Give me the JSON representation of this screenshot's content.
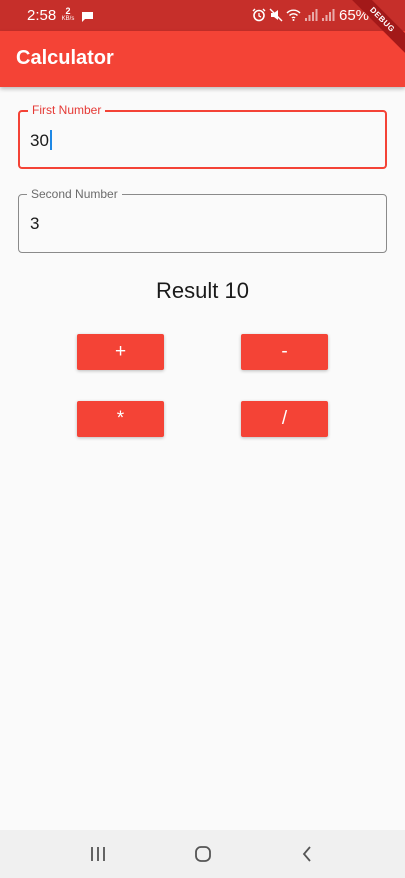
{
  "status_bar": {
    "time": "2:58",
    "data_speed_value": "2",
    "data_speed_unit": "KB/s",
    "battery": "65%",
    "icons": [
      "message-icon",
      "alarm-icon",
      "mute-icon",
      "wifi-icon",
      "signal-icon",
      "signal-icon"
    ],
    "color": "#c62f2a"
  },
  "debug_banner": {
    "label": "DEBUG"
  },
  "app_bar": {
    "title": "Calculator",
    "color": "#f44336"
  },
  "form": {
    "first_number": {
      "label": "First Number",
      "value": "30",
      "focused": true
    },
    "second_number": {
      "label": "Second Number",
      "value": "3",
      "focused": false
    }
  },
  "result": {
    "text": "Result 10"
  },
  "operators": {
    "add": "+",
    "subtract": "-",
    "multiply": "*",
    "divide": "/"
  },
  "nav_bar": {
    "icons": [
      "recent-apps-icon",
      "home-icon",
      "back-icon"
    ]
  }
}
